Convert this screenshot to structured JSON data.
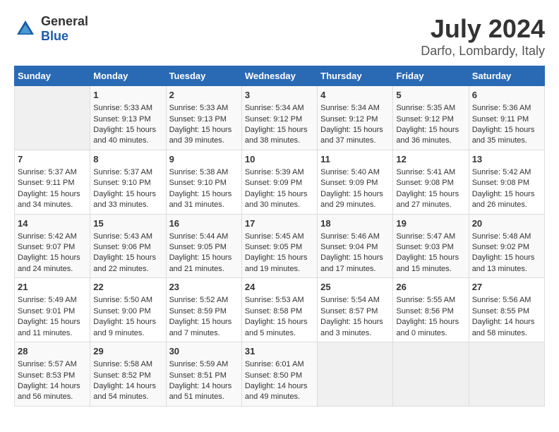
{
  "header": {
    "logo": {
      "general": "General",
      "blue": "Blue"
    },
    "title": "July 2024",
    "subtitle": "Darfo, Lombardy, Italy"
  },
  "calendar": {
    "days_of_week": [
      "Sunday",
      "Monday",
      "Tuesday",
      "Wednesday",
      "Thursday",
      "Friday",
      "Saturday"
    ],
    "weeks": [
      [
        {
          "day": "",
          "content": ""
        },
        {
          "day": "1",
          "content": "Sunrise: 5:33 AM\nSunset: 9:13 PM\nDaylight: 15 hours\nand 40 minutes."
        },
        {
          "day": "2",
          "content": "Sunrise: 5:33 AM\nSunset: 9:13 PM\nDaylight: 15 hours\nand 39 minutes."
        },
        {
          "day": "3",
          "content": "Sunrise: 5:34 AM\nSunset: 9:12 PM\nDaylight: 15 hours\nand 38 minutes."
        },
        {
          "day": "4",
          "content": "Sunrise: 5:34 AM\nSunset: 9:12 PM\nDaylight: 15 hours\nand 37 minutes."
        },
        {
          "day": "5",
          "content": "Sunrise: 5:35 AM\nSunset: 9:12 PM\nDaylight: 15 hours\nand 36 minutes."
        },
        {
          "day": "6",
          "content": "Sunrise: 5:36 AM\nSunset: 9:11 PM\nDaylight: 15 hours\nand 35 minutes."
        }
      ],
      [
        {
          "day": "7",
          "content": "Sunrise: 5:37 AM\nSunset: 9:11 PM\nDaylight: 15 hours\nand 34 minutes."
        },
        {
          "day": "8",
          "content": "Sunrise: 5:37 AM\nSunset: 9:10 PM\nDaylight: 15 hours\nand 33 minutes."
        },
        {
          "day": "9",
          "content": "Sunrise: 5:38 AM\nSunset: 9:10 PM\nDaylight: 15 hours\nand 31 minutes."
        },
        {
          "day": "10",
          "content": "Sunrise: 5:39 AM\nSunset: 9:09 PM\nDaylight: 15 hours\nand 30 minutes."
        },
        {
          "day": "11",
          "content": "Sunrise: 5:40 AM\nSunset: 9:09 PM\nDaylight: 15 hours\nand 29 minutes."
        },
        {
          "day": "12",
          "content": "Sunrise: 5:41 AM\nSunset: 9:08 PM\nDaylight: 15 hours\nand 27 minutes."
        },
        {
          "day": "13",
          "content": "Sunrise: 5:42 AM\nSunset: 9:08 PM\nDaylight: 15 hours\nand 26 minutes."
        }
      ],
      [
        {
          "day": "14",
          "content": "Sunrise: 5:42 AM\nSunset: 9:07 PM\nDaylight: 15 hours\nand 24 minutes."
        },
        {
          "day": "15",
          "content": "Sunrise: 5:43 AM\nSunset: 9:06 PM\nDaylight: 15 hours\nand 22 minutes."
        },
        {
          "day": "16",
          "content": "Sunrise: 5:44 AM\nSunset: 9:05 PM\nDaylight: 15 hours\nand 21 minutes."
        },
        {
          "day": "17",
          "content": "Sunrise: 5:45 AM\nSunset: 9:05 PM\nDaylight: 15 hours\nand 19 minutes."
        },
        {
          "day": "18",
          "content": "Sunrise: 5:46 AM\nSunset: 9:04 PM\nDaylight: 15 hours\nand 17 minutes."
        },
        {
          "day": "19",
          "content": "Sunrise: 5:47 AM\nSunset: 9:03 PM\nDaylight: 15 hours\nand 15 minutes."
        },
        {
          "day": "20",
          "content": "Sunrise: 5:48 AM\nSunset: 9:02 PM\nDaylight: 15 hours\nand 13 minutes."
        }
      ],
      [
        {
          "day": "21",
          "content": "Sunrise: 5:49 AM\nSunset: 9:01 PM\nDaylight: 15 hours\nand 11 minutes."
        },
        {
          "day": "22",
          "content": "Sunrise: 5:50 AM\nSunset: 9:00 PM\nDaylight: 15 hours\nand 9 minutes."
        },
        {
          "day": "23",
          "content": "Sunrise: 5:52 AM\nSunset: 8:59 PM\nDaylight: 15 hours\nand 7 minutes."
        },
        {
          "day": "24",
          "content": "Sunrise: 5:53 AM\nSunset: 8:58 PM\nDaylight: 15 hours\nand 5 minutes."
        },
        {
          "day": "25",
          "content": "Sunrise: 5:54 AM\nSunset: 8:57 PM\nDaylight: 15 hours\nand 3 minutes."
        },
        {
          "day": "26",
          "content": "Sunrise: 5:55 AM\nSunset: 8:56 PM\nDaylight: 15 hours\nand 0 minutes."
        },
        {
          "day": "27",
          "content": "Sunrise: 5:56 AM\nSunset: 8:55 PM\nDaylight: 14 hours\nand 58 minutes."
        }
      ],
      [
        {
          "day": "28",
          "content": "Sunrise: 5:57 AM\nSunset: 8:53 PM\nDaylight: 14 hours\nand 56 minutes."
        },
        {
          "day": "29",
          "content": "Sunrise: 5:58 AM\nSunset: 8:52 PM\nDaylight: 14 hours\nand 54 minutes."
        },
        {
          "day": "30",
          "content": "Sunrise: 5:59 AM\nSunset: 8:51 PM\nDaylight: 14 hours\nand 51 minutes."
        },
        {
          "day": "31",
          "content": "Sunrise: 6:01 AM\nSunset: 8:50 PM\nDaylight: 14 hours\nand 49 minutes."
        },
        {
          "day": "",
          "content": ""
        },
        {
          "day": "",
          "content": ""
        },
        {
          "day": "",
          "content": ""
        }
      ]
    ]
  }
}
